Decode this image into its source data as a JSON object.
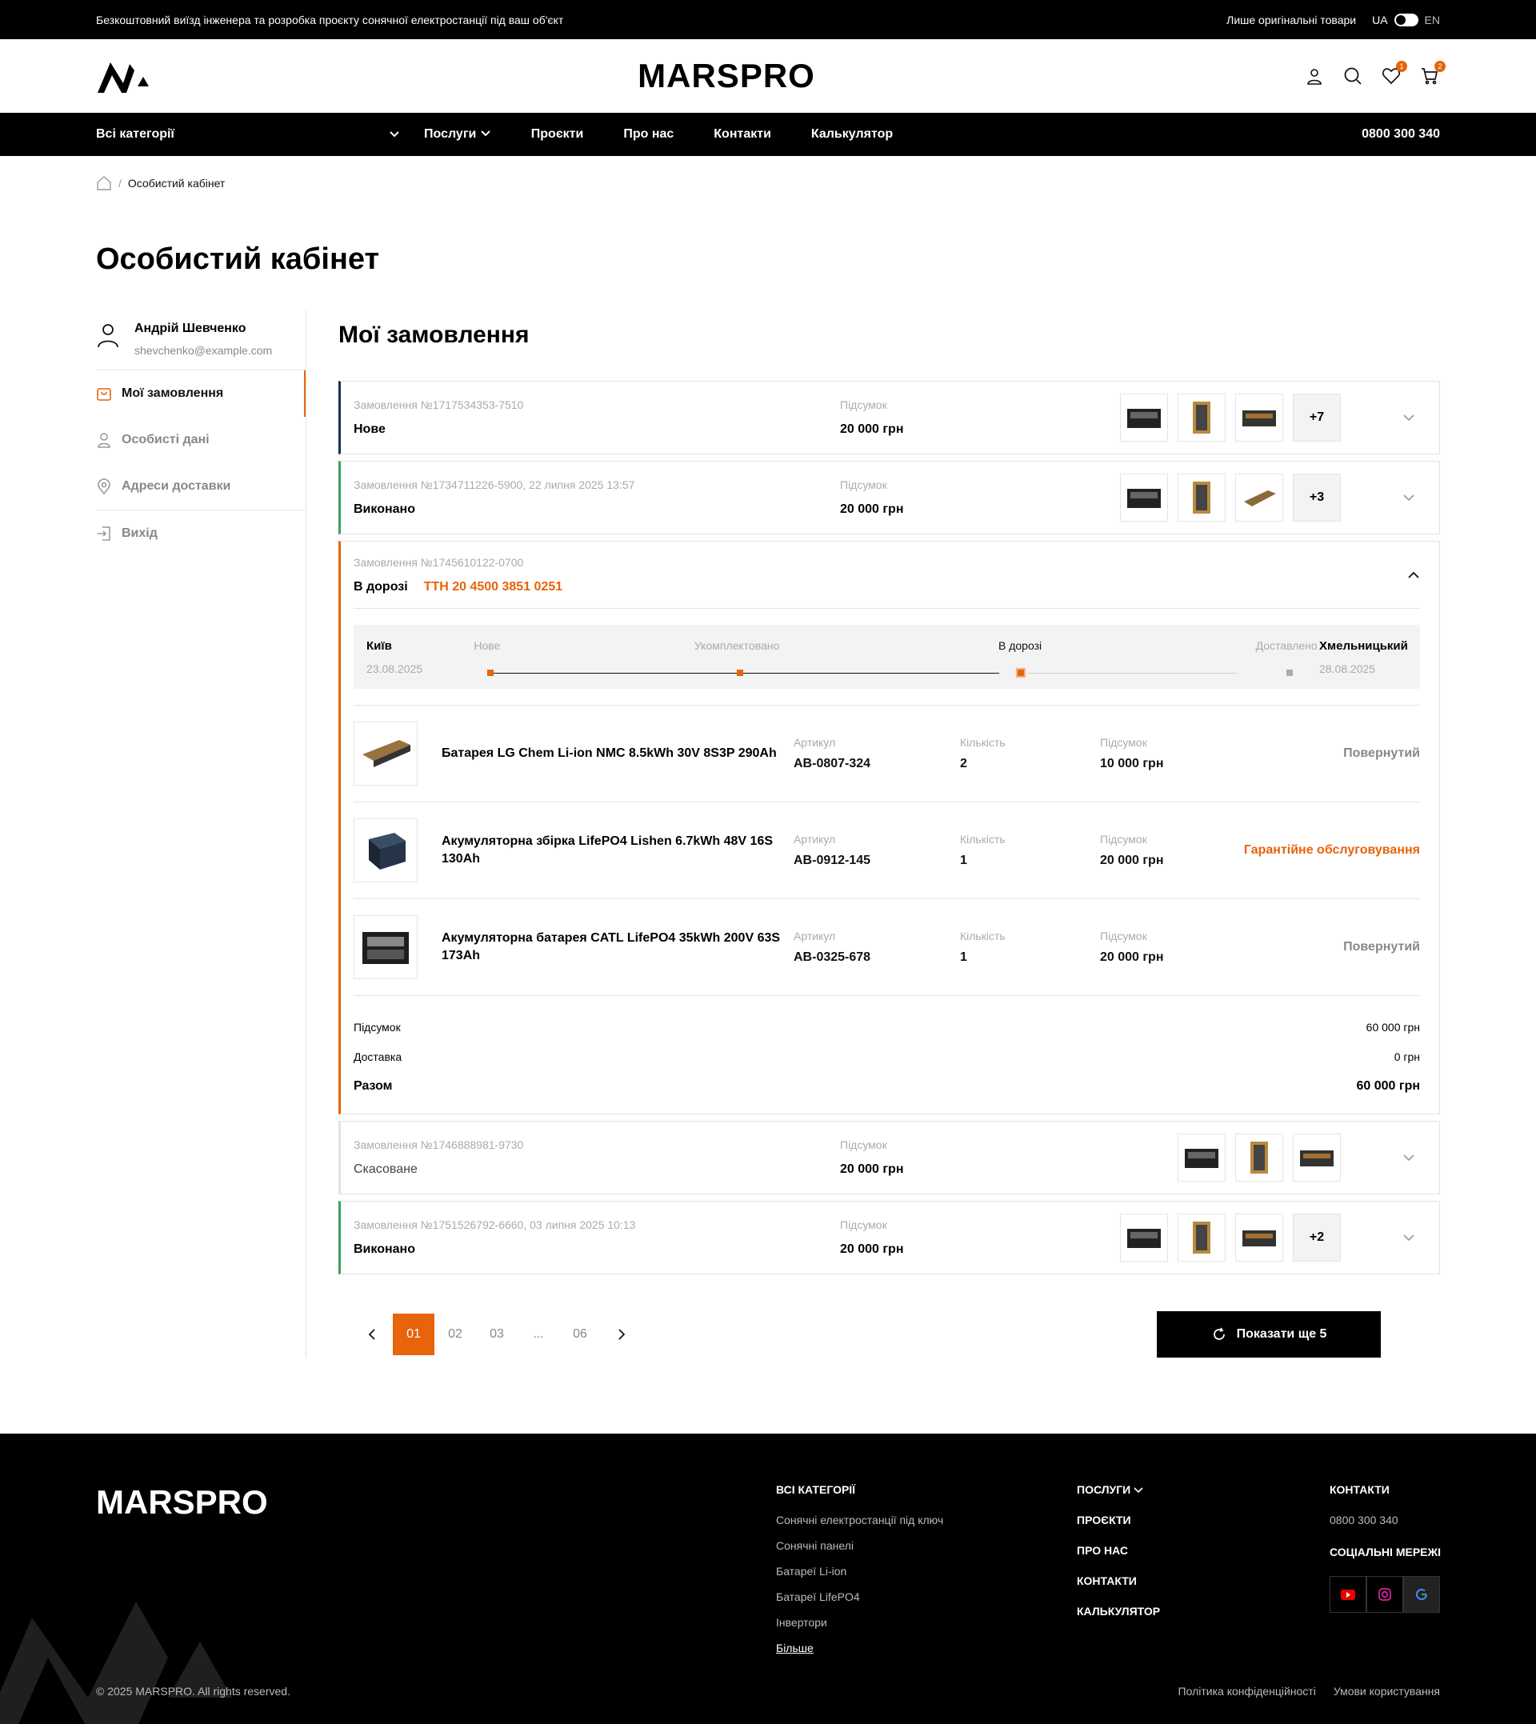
{
  "topbar": {
    "promo": "Безкоштовний виїзд інженера та розробка проєкту сонячної електростанції під ваш об'єкт",
    "original": "Лише оригінальні товари",
    "lang_ua": "UA",
    "lang_en": "EN"
  },
  "header": {
    "brand": "MARSPRO",
    "wishlist_count": "1",
    "cart_count": "2"
  },
  "nav": {
    "all_categories": "Всі категорії",
    "services": "Послуги",
    "projects": "Проєкти",
    "about": "Про нас",
    "contacts": "Контакти",
    "calculator": "Калькулятор",
    "phone": "0800 300 340"
  },
  "breadcrumb": {
    "current": "Особистий кабінет"
  },
  "page_title": "Особистий кабінет",
  "sidebar": {
    "name": "Андрій Шевченко",
    "email": "shevchenko@example.com",
    "items": [
      "Мої замовлення",
      "Особисті дані",
      "Адреси доставки",
      "Вихід"
    ]
  },
  "orders_title": "Мої замовлення",
  "labels": {
    "sum": "Підсумок",
    "article": "Артикул",
    "qty": "Кількість"
  },
  "orders": [
    {
      "num": "Замовлення №1717534353-7510",
      "status": "Нове",
      "total": "20 000 грн",
      "more": "+7",
      "color": "#1a2e5a"
    },
    {
      "num": "Замовлення №1734711226-5900, 22 липня 2025 13:57",
      "status": "Виконано",
      "total": "20 000 грн",
      "more": "+3",
      "color": "#3aa35a"
    }
  ],
  "expanded": {
    "num": "Замовлення №1745610122-0700",
    "status": "В дорозі",
    "ttn": "ТТН 20 4500 3851 0251",
    "from_city": "Київ",
    "from_date": "23.08.2025",
    "to_city": "Хмельницький",
    "to_date": "28.08.2025",
    "steps": [
      "Нове",
      "Укомплектовано",
      "В дорозі",
      "Доставлено"
    ],
    "items": [
      {
        "name": "Батарея LG Chem Li-ion NMC  8.5kWh 30V 8S3P  290Ah",
        "article": "AB-0807-324",
        "qty": "2",
        "sum": "10 000 грн",
        "action": "Повернутий"
      },
      {
        "name": "Акумуляторна збірка LifePO4 Lishen 6.7kWh 48V 16S 130Ah",
        "article": "AB-0912-145",
        "qty": "1",
        "sum": "20 000 грн",
        "action": "Гарантійне обслуговування"
      },
      {
        "name": "Акумуляторна батарея CATL  LifePO4 35kWh 200V 63S 173Ah",
        "article": "AB-0325-678",
        "qty": "1",
        "sum": "20 000 грн",
        "action": "Повернутий"
      }
    ],
    "subtotal_label": "Підсумок",
    "subtotal": "60 000 грн",
    "delivery_label": "Доставка",
    "delivery": "0 грн",
    "total_label": "Разом",
    "total": "60 000 грн"
  },
  "orders_after": [
    {
      "num": "Замовлення №1746888981-9730",
      "status": "Скасоване",
      "total": "20 000 грн",
      "more": "",
      "color": "#e2e2e2"
    },
    {
      "num": "Замовлення №1751526792-6660, 03 липня 2025 10:13",
      "status": "Виконано",
      "total": "20 000 грн",
      "more": "+2",
      "color": "#3aa35a"
    }
  ],
  "pagination": {
    "pages": [
      "01",
      "02",
      "03",
      "...",
      "06"
    ],
    "show_more": "Показати ще 5"
  },
  "footer": {
    "brand": "MARSPRO",
    "cat_title": "ВСІ КАТЕГОРІЇ",
    "cats": [
      "Сонячні електростанції під ключ",
      "Сонячні панелі",
      "Батареї Li-ion",
      "Батареї LifePO4",
      "Інвертори",
      "Більше"
    ],
    "nav": [
      "ПОСЛУГИ",
      "ПРОЄКТИ",
      "ПРО НАС",
      "КОНТАКТИ",
      "КАЛЬКУЛЯТОР"
    ],
    "contacts_title": "КОНТАКТИ",
    "phone": "0800 300 340",
    "social_title": "СОЦІАЛЬНІ МЕРЕЖІ",
    "copyright": "© 2025 MARSPRO. All rights reserved.",
    "privacy": "Політика конфіденційності",
    "terms": "Умови користування"
  }
}
